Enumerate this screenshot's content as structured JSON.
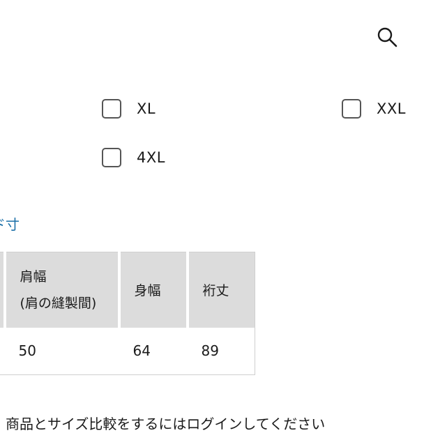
{
  "header": {
    "search_icon": "search-icon"
  },
  "size_options": [
    {
      "label": "XL",
      "checked": false
    },
    {
      "label": "XXL",
      "checked": false
    },
    {
      "label": "4XL",
      "checked": false
    }
  ],
  "dimensions_link": {
    "label": "ド寸"
  },
  "size_table": {
    "headers": {
      "shoulder_line1": "肩幅",
      "shoulder_line2": "(肩の縫製間)",
      "body_width": "身幅",
      "sleeve_length": "裄丈"
    },
    "rows": [
      {
        "shoulder": "50",
        "body_width": "64",
        "sleeve_length": "89"
      }
    ]
  },
  "login_note": "商品とサイズ比較をするにはログインしてください",
  "colors": {
    "link": "#1a6fa8",
    "header_bg": "#dcdcdc",
    "checkbox_border": "#555555"
  }
}
